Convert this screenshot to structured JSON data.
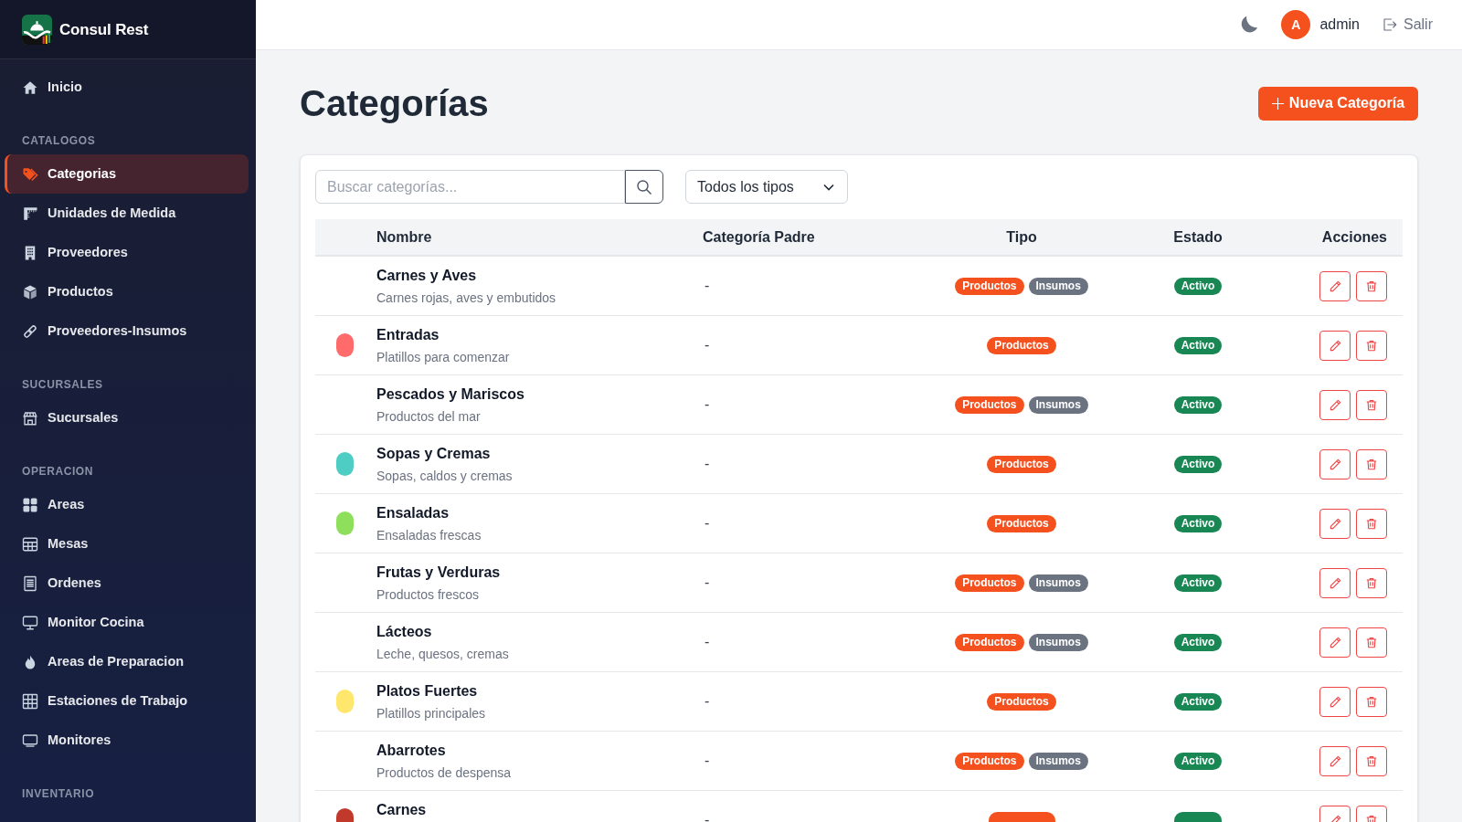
{
  "app": {
    "name": "Consul Rest"
  },
  "sidebar": {
    "sections": [
      {
        "items": [
          {
            "label": "Inicio",
            "selected": false
          }
        ]
      },
      {
        "title": "CATALOGOS",
        "items": [
          {
            "label": "Categorias",
            "selected": true
          },
          {
            "label": "Unidades de Medida",
            "selected": false
          },
          {
            "label": "Proveedores",
            "selected": false
          },
          {
            "label": "Productos",
            "selected": false
          },
          {
            "label": "Proveedores-Insumos",
            "selected": false
          }
        ]
      },
      {
        "title": "SUCURSALES",
        "items": [
          {
            "label": "Sucursales",
            "selected": false
          }
        ]
      },
      {
        "title": "OPERACION",
        "items": [
          {
            "label": "Areas",
            "selected": false
          },
          {
            "label": "Mesas",
            "selected": false
          },
          {
            "label": "Ordenes",
            "selected": false
          },
          {
            "label": "Monitor Cocina",
            "selected": false
          },
          {
            "label": "Areas de Preparacion",
            "selected": false
          },
          {
            "label": "Estaciones de Trabajo",
            "selected": false
          },
          {
            "label": "Monitores",
            "selected": false
          }
        ]
      },
      {
        "title": "INVENTARIO"
      }
    ]
  },
  "header": {
    "user": {
      "initial": "A",
      "name": "admin"
    },
    "logout": {
      "label": "Salir"
    }
  },
  "page": {
    "title": "Categorías",
    "new_button": "Nueva Categoría"
  },
  "filters": {
    "search": {
      "placeholder": "Buscar categorías..."
    },
    "type_select": {
      "value": "Todos los tipos"
    }
  },
  "table": {
    "columns": [
      "Nombre",
      "Categoría Padre",
      "Tipo",
      "Estado",
      "Acciones"
    ],
    "rows": [
      {
        "name": "Carnes y Aves",
        "description": "Carnes rojas, aves y embutidos",
        "parent": "-",
        "types": [
          {
            "label": "Productos",
            "color": "#f4511e"
          },
          {
            "label": "Insumos",
            "color": "#6b7280"
          }
        ],
        "active": true,
        "status": "Activo"
      },
      {
        "name": "Entradas",
        "description": "Platillos para comenzar",
        "parent": "-",
        "color": "#ff6b6b",
        "types": [
          {
            "label": "Productos",
            "color": "#f4511e"
          }
        ],
        "active": true,
        "status": "Activo"
      },
      {
        "name": "Pescados y Mariscos",
        "description": "Productos del mar",
        "parent": "-",
        "types": [
          {
            "label": "Productos",
            "color": "#f4511e"
          },
          {
            "label": "Insumos",
            "color": "#6b7280"
          }
        ],
        "active": true,
        "status": "Activo"
      },
      {
        "name": "Sopas y Cremas",
        "description": "Sopas, caldos y cremas",
        "parent": "-",
        "color": "#4ecdc4",
        "types": [
          {
            "label": "Productos",
            "color": "#f4511e"
          }
        ],
        "active": true,
        "status": "Activo"
      },
      {
        "name": "Ensaladas",
        "description": "Ensaladas frescas",
        "parent": "-",
        "color": "#8ee05c",
        "types": [
          {
            "label": "Productos",
            "color": "#f4511e"
          }
        ],
        "active": true,
        "status": "Activo"
      },
      {
        "name": "Frutas y Verduras",
        "description": "Productos frescos",
        "parent": "-",
        "types": [
          {
            "label": "Productos",
            "color": "#f4511e"
          },
          {
            "label": "Insumos",
            "color": "#6b7280"
          }
        ],
        "active": true,
        "status": "Activo"
      },
      {
        "name": "Lácteos",
        "description": "Leche, quesos, cremas",
        "parent": "-",
        "types": [
          {
            "label": "Productos",
            "color": "#f4511e"
          },
          {
            "label": "Insumos",
            "color": "#6b7280"
          }
        ],
        "active": true,
        "status": "Activo"
      },
      {
        "name": "Platos Fuertes",
        "description": "Platillos principales",
        "parent": "-",
        "color": "#ffe66d",
        "types": [
          {
            "label": "Productos",
            "color": "#f4511e"
          }
        ],
        "active": true,
        "status": "Activo"
      },
      {
        "name": "Abarrotes",
        "description": "Productos de despensa",
        "parent": "-",
        "types": [
          {
            "label": "Productos",
            "color": "#f4511e"
          },
          {
            "label": "Insumos",
            "color": "#6b7280"
          }
        ],
        "active": true,
        "status": "Activo"
      },
      {
        "name": "Carnes",
        "parent": "-",
        "color": "#c0392b",
        "types": [
          {
            "color": "#f4511e"
          }
        ],
        "active": true
      }
    ]
  }
}
